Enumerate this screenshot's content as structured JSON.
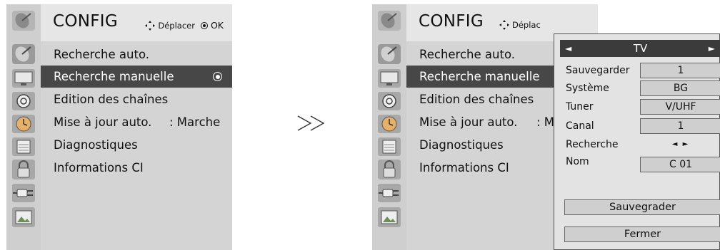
{
  "left_panel": {
    "title": "CONFIG",
    "hint_move": "Déplacer",
    "hint_ok": "OK",
    "items": [
      {
        "label": "Recherche auto.",
        "value": ""
      },
      {
        "label": "Recherche manuelle",
        "value": ""
      },
      {
        "label": "Edition des chaînes",
        "value": ""
      },
      {
        "label": "Mise à jour auto.",
        "value": ": Marche"
      },
      {
        "label": "Diagnostiques",
        "value": ""
      },
      {
        "label": "Informations CI",
        "value": ""
      }
    ],
    "selected_index": 1
  },
  "transition_arrow": "≫",
  "right_panel": {
    "title": "CONFIG",
    "hint_move": "Déplac",
    "items": [
      {
        "label": "Recherche auto.",
        "value": ""
      },
      {
        "label": "Recherche manuelle",
        "value": ""
      },
      {
        "label": "Edition des chaînes",
        "value": ""
      },
      {
        "label": "Mise à jour auto.",
        "value": ": M"
      },
      {
        "label": "Diagnostiques",
        "value": ""
      },
      {
        "label": "Informations CI",
        "value": ""
      }
    ]
  },
  "dialog": {
    "source": "TV",
    "left_arrow": "◄",
    "right_arrow": "►",
    "rows": [
      {
        "label": "Sauvegarder",
        "value": "1"
      },
      {
        "label": "Système",
        "value": "BG"
      },
      {
        "label": "Tuner",
        "value": "V/UHF"
      },
      {
        "label": "Canal",
        "value": "1"
      },
      {
        "label": "Recherche",
        "value": "◄ ►"
      },
      {
        "label": "Nom",
        "value": "C  01"
      }
    ],
    "save_button": "Sauvegrader",
    "close_button": "Fermer"
  },
  "sidebar_icons": [
    "satellite-dish-icon",
    "tv-screen-icon",
    "speaker-icon",
    "clock-icon",
    "calendar-lock-icon",
    "padlock-icon",
    "plug-icon",
    "photo-icon"
  ]
}
